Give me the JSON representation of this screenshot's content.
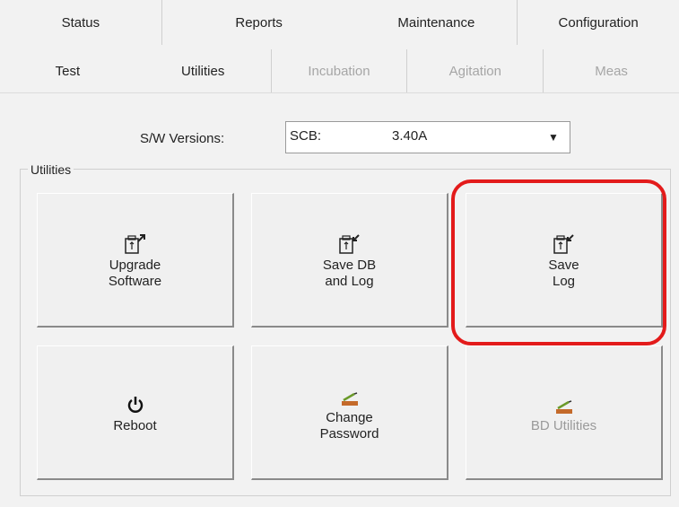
{
  "tabs_top": [
    "Status",
    "Reports",
    "Maintenance",
    "Configuration"
  ],
  "tabs_sub": [
    {
      "label": "Test",
      "state": "normal"
    },
    {
      "label": "Utilities",
      "state": "active"
    },
    {
      "label": "Incubation",
      "state": "disabled"
    },
    {
      "label": "Agitation",
      "state": "disabled"
    },
    {
      "label": "Meas",
      "state": "disabled"
    }
  ],
  "versions": {
    "label": "S/W Versions:",
    "selected_key": "SCB:",
    "selected_value": "3.40A"
  },
  "utilities": {
    "title": "Utilities",
    "buttons": [
      {
        "line1": "Upgrade",
        "line2": "Software",
        "icon": "usb-upload-icon",
        "enabled": true
      },
      {
        "line1": "Save DB",
        "line2": "and Log",
        "icon": "usb-save-icon",
        "enabled": true
      },
      {
        "line1": "Save",
        "line2": "Log",
        "icon": "usb-save-icon",
        "enabled": true
      },
      {
        "line1": "Reboot",
        "line2": "",
        "icon": "power-icon",
        "enabled": true
      },
      {
        "line1": "Change",
        "line2": "Password",
        "icon": "keyboard-pen-icon",
        "enabled": true
      },
      {
        "line1": "BD Utilities",
        "line2": "",
        "icon": "keyboard-pen-icon",
        "enabled": false
      }
    ]
  },
  "colors": {
    "highlight": "#e31b1b",
    "disabled_text": "#a6a6a6"
  }
}
